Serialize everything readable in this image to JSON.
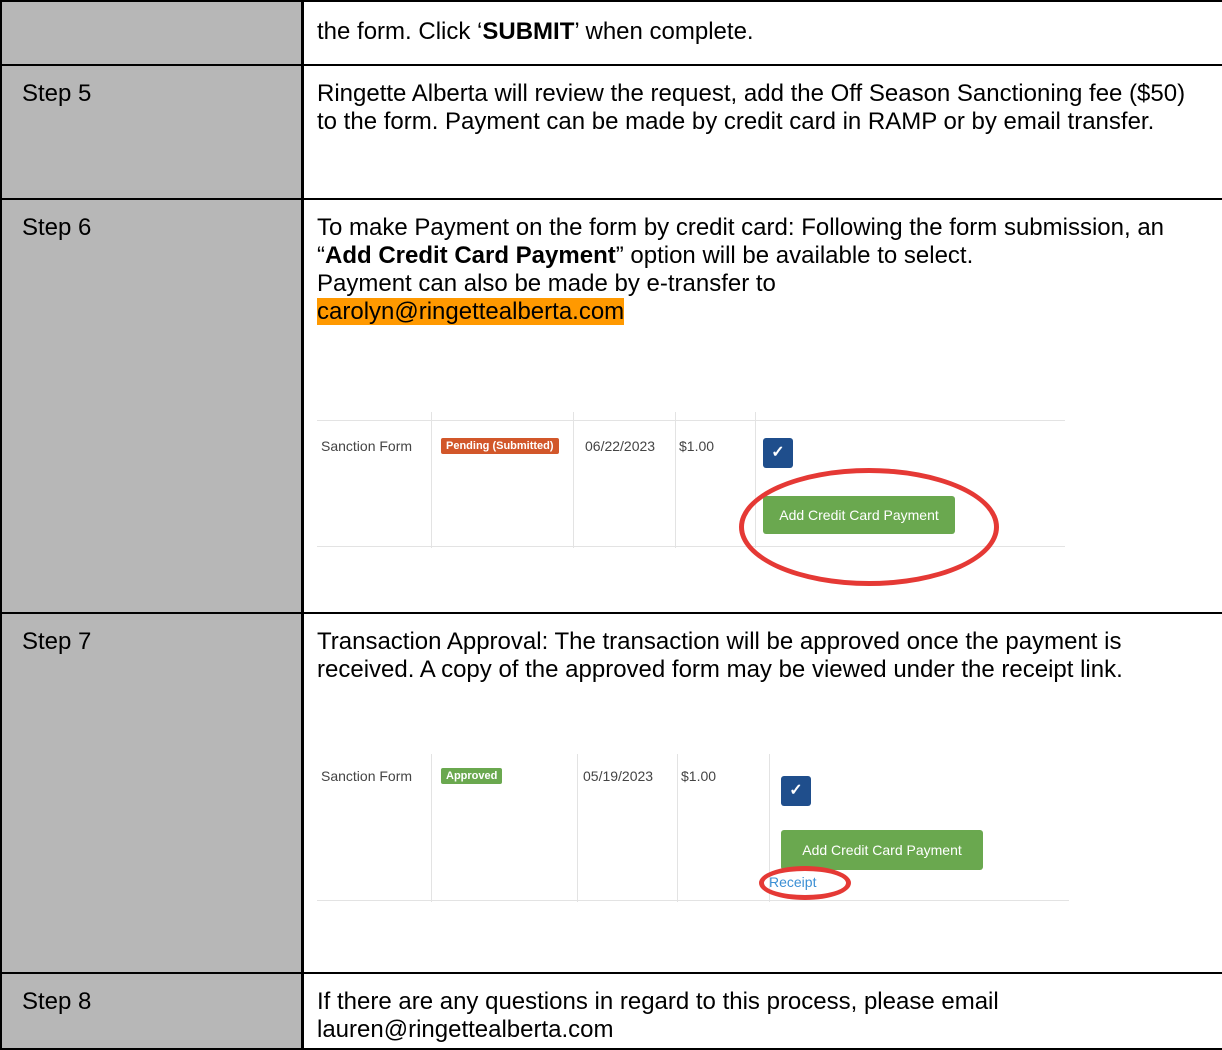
{
  "rows": {
    "r4": {
      "text_a": "the form. Click ‘",
      "bold": "SUBMIT",
      "text_b": "’ when complete."
    },
    "r5": {
      "step": "Step 5",
      "text": "Ringette Alberta will review the request, add the Off Season Sanctioning fee ($50) to the form. Payment can be made by credit card in RAMP or by email transfer."
    },
    "r6": {
      "step": "Step 6",
      "line1": "To make Payment on the form by credit card: Following the form submission, an “",
      "bold": "Add Credit Card Payment",
      "line1b": "” option will be available to select.",
      "line2": "Payment can also be made by e-transfer to",
      "email": "carolyn@ringettealberta.com",
      "shot": {
        "form": "Sanction Form",
        "status": "Pending (Submitted)",
        "status_color": "#d2572a",
        "date": "06/22/2023",
        "amount": "$1.00",
        "edit_icon": "✓",
        "button": "Add Credit Card Payment"
      }
    },
    "r7": {
      "step": "Step 7",
      "text": "Transaction Approval: The transaction will be approved once the payment is received. A copy of the approved form may be viewed under the receipt link.",
      "shot": {
        "form": "Sanction Form",
        "status": "Approved",
        "status_color": "#6aa84f",
        "date": "05/19/2023",
        "amount": "$1.00",
        "edit_icon": "✓",
        "button": "Add Credit Card Payment",
        "receipt": "Receipt"
      }
    },
    "r8": {
      "step": "Step 8",
      "text": "If there are any questions in regard to this process, please email lauren@ringettealberta.com"
    }
  }
}
